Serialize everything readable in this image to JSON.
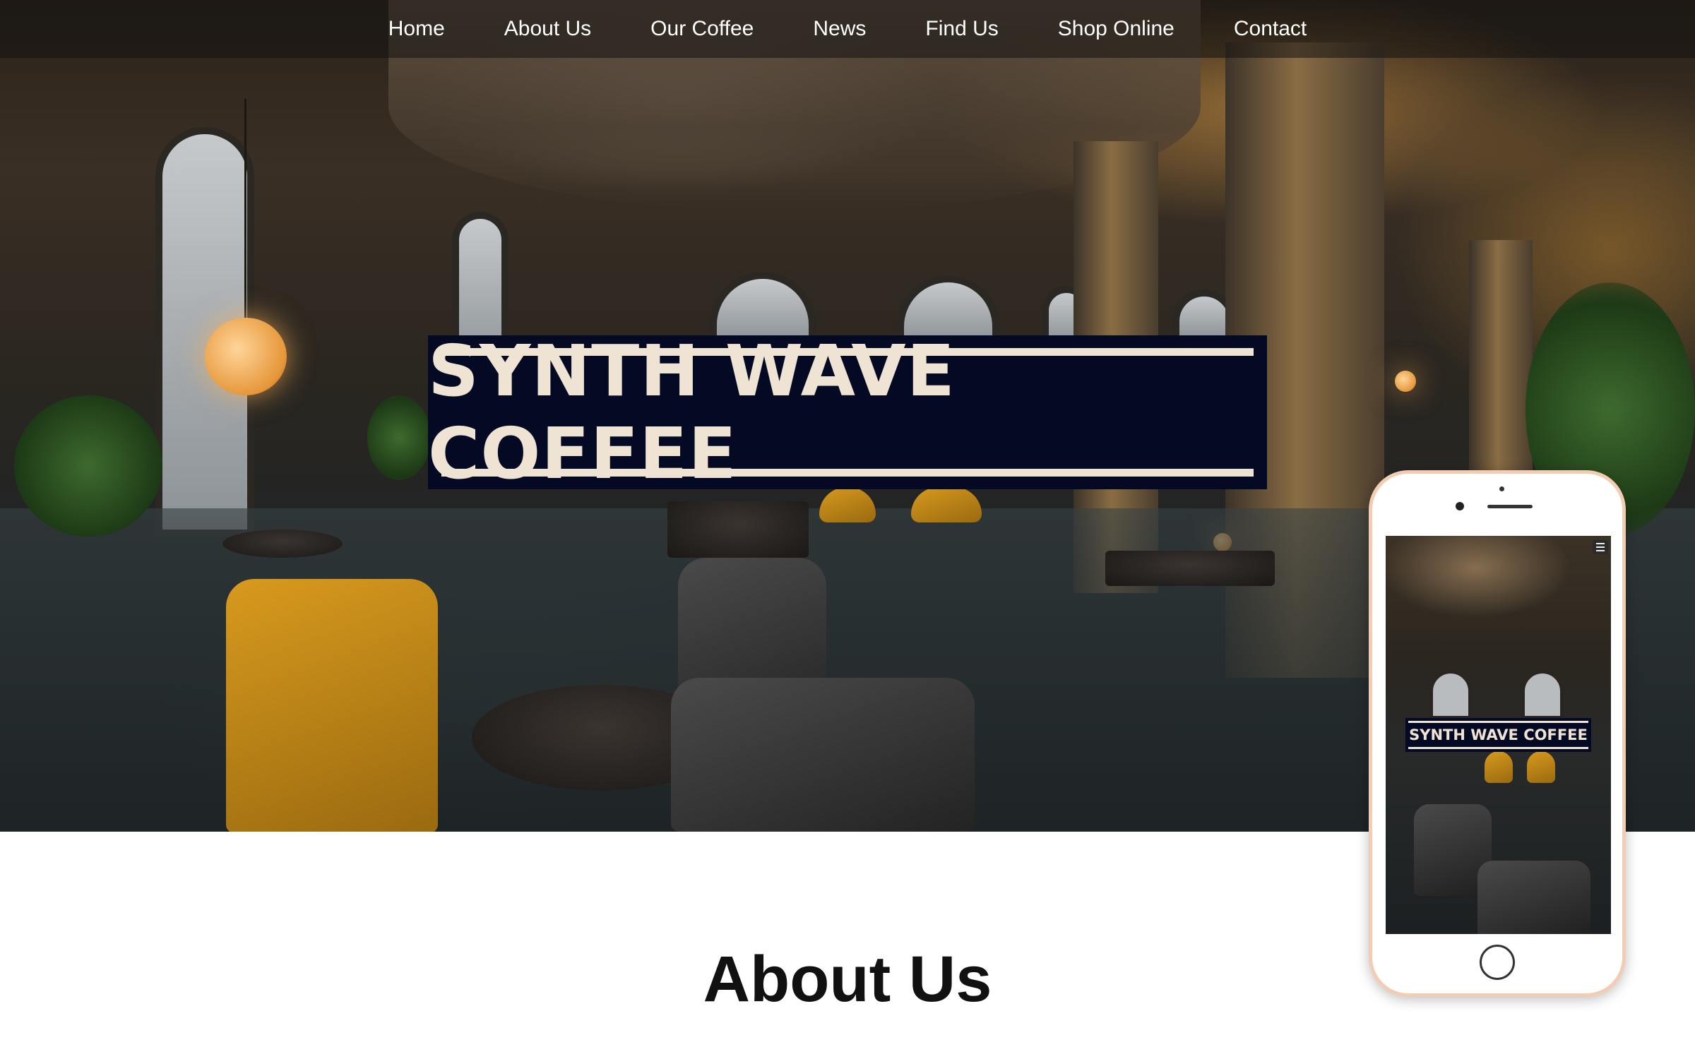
{
  "nav": {
    "items": [
      {
        "label": "Home"
      },
      {
        "label": "About Us"
      },
      {
        "label": "Our Coffee"
      },
      {
        "label": "News"
      },
      {
        "label": "Find Us"
      },
      {
        "label": "Shop Online"
      },
      {
        "label": "Contact"
      }
    ]
  },
  "hero": {
    "title": "SYNTH WAVE COFFEE",
    "background_image": "coffee shop interior with arched windows, pendant lamps, yellow and grey armchairs"
  },
  "about": {
    "heading": "About Us"
  },
  "phone_preview": {
    "title": "SYNTH WAVE COFFEE",
    "menu_icon": "hamburger-menu-icon"
  },
  "colors": {
    "title_box": "#050a24",
    "title_text": "#efe3d3",
    "nav_bg": "rgba(20,18,16,0.55)",
    "phone_frame": "#f2cdb4"
  }
}
